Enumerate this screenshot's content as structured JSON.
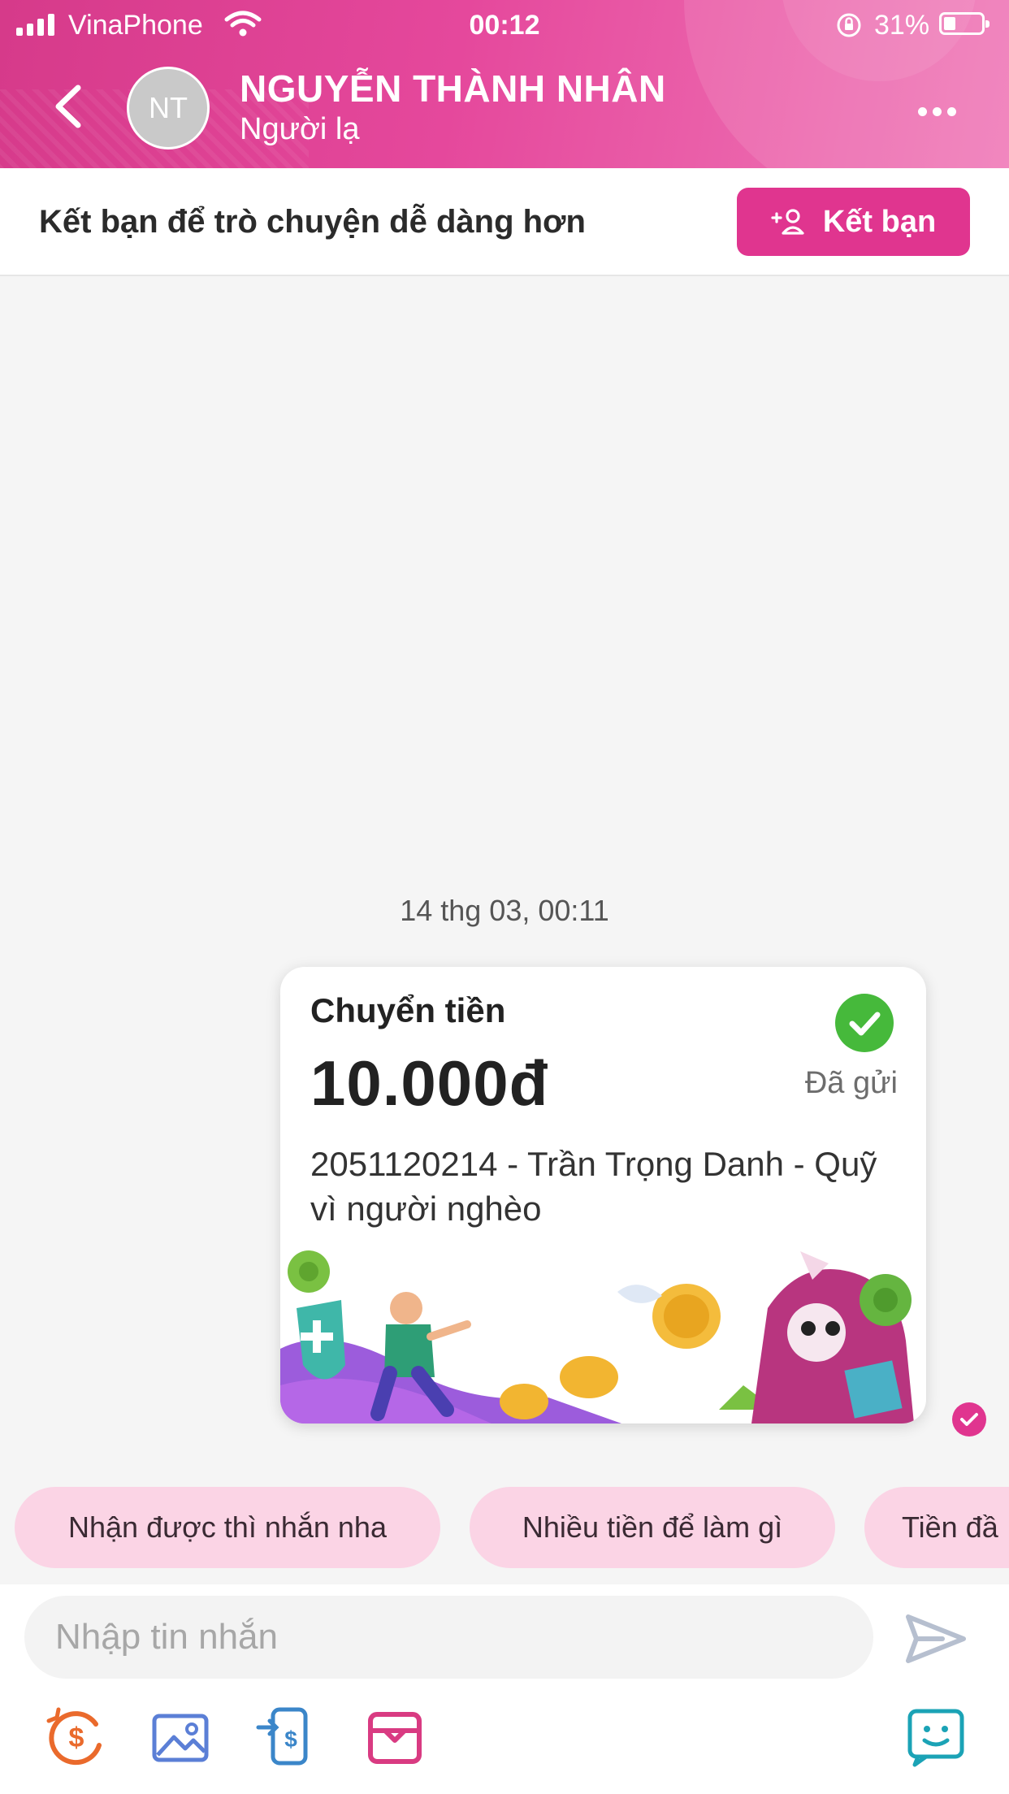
{
  "status_bar": {
    "carrier": "VinaPhone",
    "time": "00:12",
    "battery": "31%"
  },
  "header": {
    "avatar_initials": "NT",
    "name": "NGUYỄN THÀNH NHÂN",
    "subtitle": "Người lạ"
  },
  "friend_bar": {
    "text": "Kết bạn để trò chuyện dễ dàng hơn",
    "button_label": "Kết bạn"
  },
  "chat": {
    "timestamp": "14 thg 03, 00:11",
    "transfer_card": {
      "title": "Chuyển tiền",
      "amount": "10.000đ",
      "status": "Đã gửi",
      "description": "2051120214 - Trần Trọng Danh - Quỹ vì người nghèo"
    }
  },
  "quick_replies": [
    "Nhận được thì nhắn nha",
    "Nhiều tiền để làm gì",
    "Tiền đầ"
  ],
  "input": {
    "placeholder": "Nhập tin nhắn"
  },
  "toolbar_icons": [
    "money-icon",
    "image-icon",
    "transfer-icon",
    "gift-icon",
    "sticker-icon"
  ],
  "colors": {
    "brand": "#e0358f",
    "chip_bg": "#fbd4e5",
    "success": "#46b93b"
  }
}
